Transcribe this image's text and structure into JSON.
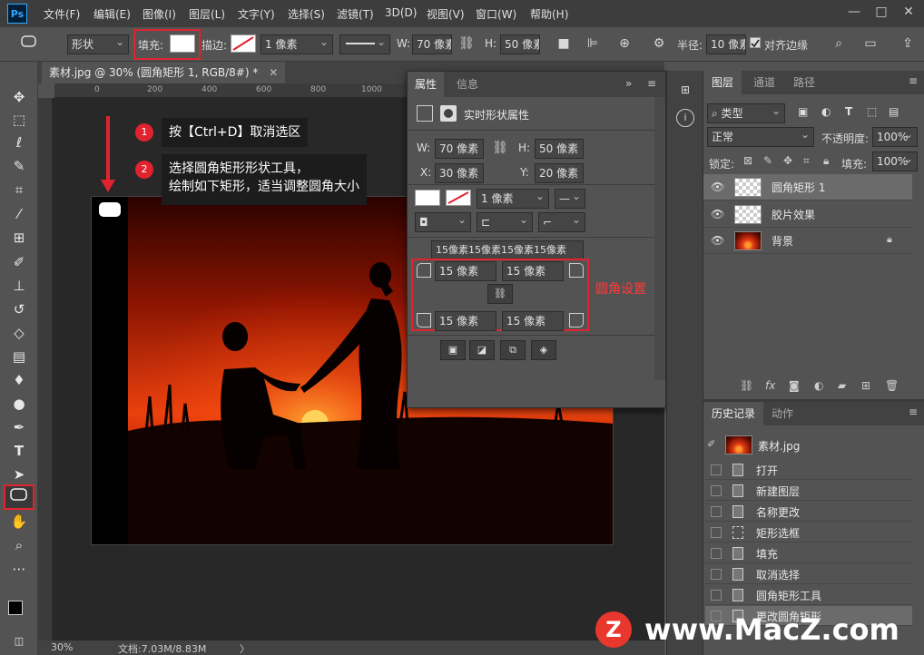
{
  "app": {
    "logo": "Ps",
    "menu": [
      "文件(F)",
      "编辑(E)",
      "图像(I)",
      "图层(L)",
      "文字(Y)",
      "选择(S)",
      "滤镜(T)",
      "3D(D)",
      "视图(V)",
      "窗口(W)",
      "帮助(H)"
    ],
    "window_controls": [
      "—",
      "□",
      "✕"
    ]
  },
  "options": {
    "mode": "形状",
    "fill_label": "填充:",
    "stroke_label": "描边:",
    "stroke_width": "1 像素",
    "w_label": "W:",
    "w_value": "70 像素",
    "h_label": "H:",
    "h_value": "50 像素",
    "radius_label": "半径:",
    "radius_value": "10 像素",
    "align_edges_label": "对齐边缘"
  },
  "document": {
    "tab_title": "素材.jpg @ 30% (圆角矩形 1, RGB/8#) *",
    "ruler_marks": [
      "0",
      "200",
      "400",
      "600",
      "800",
      "1000",
      "1200",
      "1400"
    ],
    "zoom": "30%",
    "doc_size": "文档:7.03M/8.83M",
    "status_arrow": "〉"
  },
  "steps": [
    {
      "num": "1",
      "text": "按【Ctrl+D】取消选区"
    },
    {
      "num": "2",
      "line1": "选择圆角矩形形状工具，",
      "line2": "绘制如下矩形，适当调整圆角大小"
    }
  ],
  "properties": {
    "tabs": [
      "属性",
      "信息"
    ],
    "header": "实时形状属性",
    "w_label": "W:",
    "w_value": "70 像素",
    "h_label": "H:",
    "h_value": "50 像素",
    "x_label": "X:",
    "x_value": "30 像素",
    "y_label": "Y:",
    "y_value": "20 像素",
    "stroke_width": "1 像素",
    "radius_summary": "15像素15像素15像素15像素",
    "tl": "15 像素",
    "tr": "15 像素",
    "bl": "15 像素",
    "br": "15 像素",
    "annotation": "圆角设置"
  },
  "layers": {
    "tabs": [
      "图层",
      "通道",
      "路径"
    ],
    "kind_filter": "类型",
    "blend_mode": "正常",
    "opacity_label": "不透明度:",
    "opacity_value": "100%",
    "lock_label": "锁定:",
    "fill_label": "填充:",
    "fill_value": "100%",
    "items": [
      {
        "name": "圆角矩形 1",
        "selected": true
      },
      {
        "name": "胶片效果",
        "selected": false
      },
      {
        "name": "背景",
        "selected": false
      }
    ]
  },
  "history": {
    "tabs": [
      "历史记录",
      "动作"
    ],
    "snapshot": "素材.jpg",
    "items": [
      "打开",
      "新建图层",
      "名称更改",
      "矩形选框",
      "填充",
      "取消选择",
      "圆角矩形工具",
      "更改圆角矩形"
    ]
  },
  "watermark": {
    "logo": "Z",
    "text": "www.MacZ.com"
  }
}
